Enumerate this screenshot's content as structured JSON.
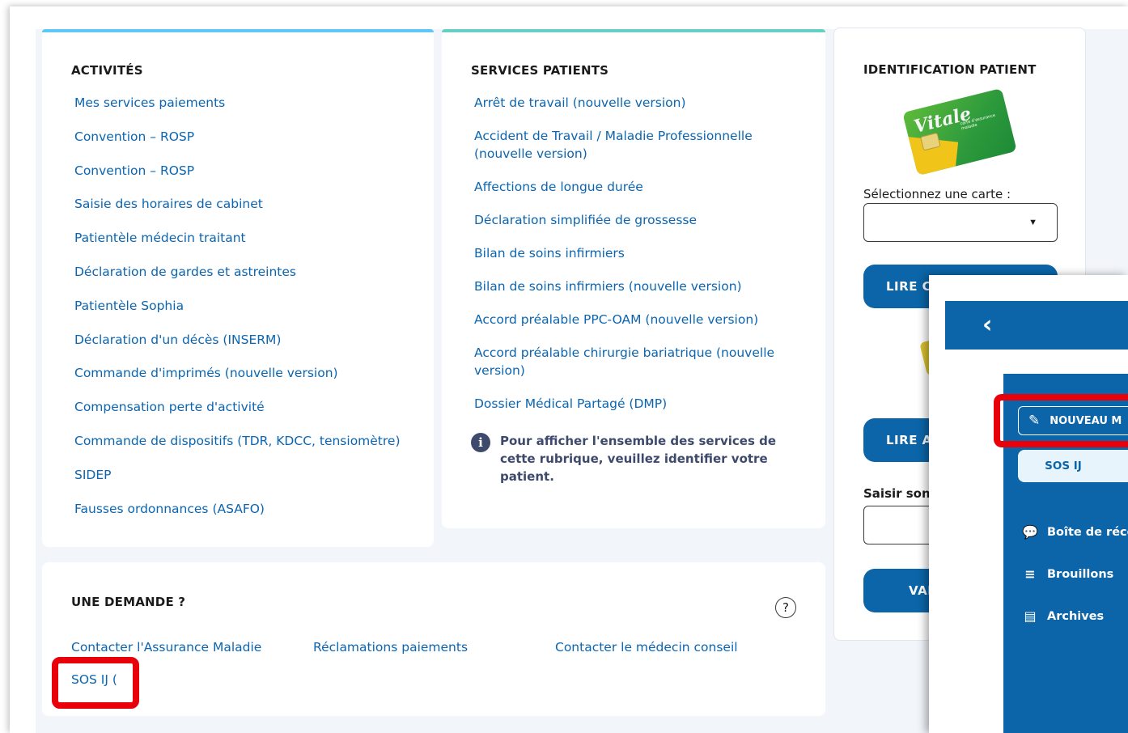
{
  "activites": {
    "title": "ACTIVITÉS",
    "links": [
      "Mes services paiements",
      "Convention – ROSP",
      "Convention – ROSP",
      "Saisie des horaires de cabinet",
      "Patientèle médecin traitant",
      "Déclaration de gardes et astreintes",
      "Patientèle Sophia",
      "Déclaration d'un décès (INSERM)",
      "Commande d'imprimés (nouvelle version)",
      "Compensation perte d'activité",
      "Commande de dispositifs (TDR, KDCC, tensiomètre)",
      "SIDEP",
      "Fausses ordonnances (ASAFO)"
    ]
  },
  "services_patients": {
    "title": "SERVICES PATIENTS",
    "links": [
      "Arrêt de travail (nouvelle version)",
      "Accident de Travail / Maladie Professionnelle (nouvelle version)",
      "Affections de longue durée",
      "Déclaration simplifiée de grossesse",
      "Bilan de soins infirmiers",
      "Bilan de soins infirmiers (nouvelle version)",
      "Accord préalable PPC-OAM (nouvelle version)",
      "Accord préalable chirurgie bariatrique (nouvelle version)",
      "Dossier Médical Partagé (DMP)"
    ],
    "info": "Pour afficher l'ensemble des services de cette rubrique, veuillez identifier votre patient."
  },
  "identification": {
    "title": "IDENTIFICATION PATIENT",
    "card_brand": "Vitale",
    "card_sub": "carte d'assurance maladie",
    "select_label": "Sélectionnez une carte :",
    "select_value": "",
    "btn_lire_carte": "LIRE CA",
    "btn_lire_app": "LIRE AP",
    "nir_label": "Saisir son N",
    "nir_value": "",
    "btn_valider": "VAL"
  },
  "demande": {
    "title": "UNE DEMANDE ?",
    "help": "?",
    "links": [
      "Contacter l'Assurance Maladie",
      "Réclamations paiements",
      "Contacter le médecin conseil"
    ],
    "sos": "SOS IJ ("
  },
  "messagerie": {
    "back": "‹",
    "new_message": "NOUVEAU M",
    "sos": "SOS IJ",
    "items": [
      "Boîte de réce",
      "Brouillons",
      "Archives"
    ]
  },
  "colors": {
    "link": "#0b65b1",
    "primary": "#0b65a8",
    "highlight": "#e8000b"
  }
}
